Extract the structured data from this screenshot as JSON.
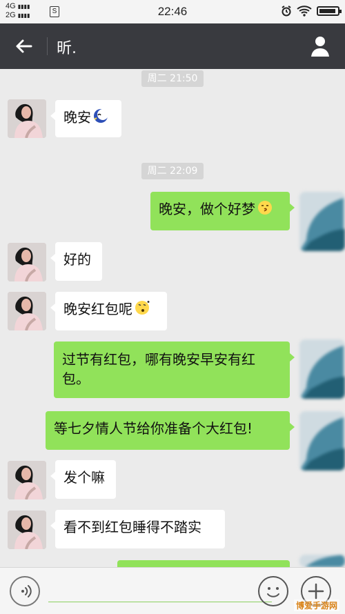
{
  "status_bar": {
    "network_1": "4G",
    "network_2": "2G",
    "sim_label": "S",
    "time": "22:46",
    "battery_level": 0.93
  },
  "header": {
    "title": "昕."
  },
  "messages": [
    {
      "type": "time",
      "text": "周二 21:50"
    },
    {
      "type": "in",
      "text": "晚安",
      "emoji": "moon-emoji"
    },
    {
      "type": "time",
      "text": "周二 22:09"
    },
    {
      "type": "out",
      "text": "晚安，做个好梦",
      "emoji": "kiss-emoji"
    },
    {
      "type": "in",
      "text": "好的"
    },
    {
      "type": "in",
      "text": "晚安红包呢",
      "emoji": "dizzy-emoji"
    },
    {
      "type": "out",
      "text": "过节有红包，哪有晚安早安有红包。"
    },
    {
      "type": "out",
      "text": "等七夕情人节给你准备个大红包!"
    },
    {
      "type": "in",
      "text": "发个嘛"
    },
    {
      "type": "in",
      "text": "看不到红包睡得不踏实"
    }
  ],
  "watermark": "博爱手游网",
  "colors": {
    "title_bar": "#393a3f",
    "incoming_bubble": "#ffffff",
    "outgoing_bubble": "#91e25a",
    "chat_background": "#ebebeb",
    "watermark": "#d98318"
  }
}
